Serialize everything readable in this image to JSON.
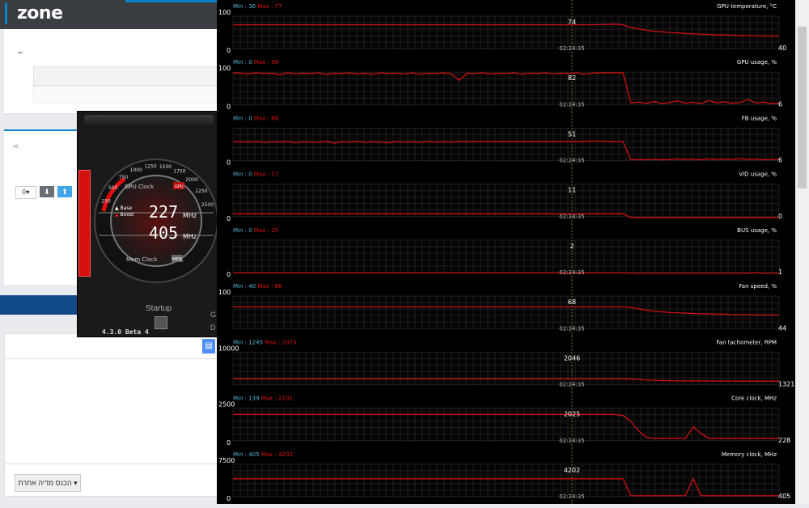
{
  "site": {
    "logo": "zone",
    "like_count": "0",
    "like_heart": "♥",
    "down_arrow": "⬇",
    "up_arrow": "⬆",
    "share_glyph": "⋖",
    "other_media_button": "הכנס מדיה אחרת ▾",
    "doc_glyph": "▤"
  },
  "afterburner": {
    "gpu_clock_label": "GPU Clock",
    "mem_clock_label": "Mem Clock",
    "gpu_badge": "GPU",
    "mem_badge": "MEM",
    "base_label": "Base",
    "boost_label": "Boost",
    "gpu_clock_value": "227",
    "mem_clock_value": "405",
    "unit": "MHz",
    "startup_label": "Startup",
    "version": "4.3.0 Beta 4",
    "side_letters": [
      "G",
      "D"
    ],
    "dial_ticks": [
      "250",
      "500",
      "750",
      "1000",
      "1250",
      "1500",
      "1750",
      "2000",
      "2250",
      "2500"
    ],
    "colors": {
      "accent": "#e01010"
    }
  },
  "monitor": {
    "cursor_time": "02:24:35",
    "graphs": [
      {
        "title": "GPU temperature, °C",
        "min": "36",
        "max": "77",
        "ymax": "100",
        "ymin": "0",
        "cur": "74",
        "end": "40",
        "data": [
          74,
          74,
          74,
          74,
          74,
          74,
          74,
          74,
          74,
          74,
          74,
          74,
          74,
          74,
          74,
          74,
          74,
          74,
          74,
          74,
          74,
          74,
          74,
          74,
          74,
          74,
          74,
          74,
          74,
          74,
          74,
          74,
          74,
          74,
          74,
          74,
          74,
          74,
          74,
          74,
          74,
          74,
          74,
          74,
          74,
          74,
          74,
          75,
          75,
          76,
          74,
          66,
          62,
          58,
          55,
          53,
          51,
          50,
          48,
          47,
          46,
          45,
          44,
          44,
          43,
          42,
          42,
          41,
          41,
          40,
          40
        ]
      },
      {
        "title": "GPU usage, %",
        "min": "0",
        "max": "99",
        "ymax": "100",
        "ymin": "0",
        "cur": "82",
        "end": "6",
        "noisy": true,
        "data": [
          98,
          97,
          95,
          98,
          96,
          97,
          92,
          98,
          95,
          97,
          96,
          98,
          93,
          97,
          96,
          98,
          95,
          97,
          94,
          98,
          96,
          97,
          95,
          98,
          94,
          97,
          96,
          98,
          95,
          75,
          97,
          96,
          98,
          95,
          97,
          96,
          98,
          94,
          97,
          96,
          98,
          95,
          97,
          96,
          98,
          94,
          97,
          98,
          98,
          98,
          98,
          8,
          10,
          7,
          12,
          6,
          9,
          14,
          7,
          10,
          6,
          15,
          8,
          11,
          7,
          9,
          18,
          8,
          10,
          6,
          6
        ]
      },
      {
        "title": "FB usage, %",
        "min": "0",
        "max": "68",
        "ymax": "",
        "ymin": "0",
        "cur": "51",
        "end": "6",
        "noisy": true,
        "data": [
          60,
          59,
          58,
          60,
          57,
          59,
          58,
          60,
          56,
          59,
          58,
          57,
          60,
          55,
          59,
          58,
          60,
          57,
          59,
          58,
          56,
          60,
          58,
          59,
          57,
          60,
          58,
          59,
          58,
          60,
          59,
          60,
          60,
          60,
          60,
          60,
          60,
          60,
          60,
          60,
          60,
          60,
          60,
          60,
          60,
          60,
          61,
          61,
          60,
          60,
          59,
          5,
          6,
          5,
          7,
          5,
          6,
          8,
          6,
          7,
          5,
          8,
          6,
          7,
          6,
          9,
          6,
          7,
          5,
          6,
          6
        ]
      },
      {
        "title": "VID usage, %",
        "min": "0",
        "max": "17",
        "ymax": "",
        "ymin": "0",
        "cur": "11",
        "end": "0",
        "data": [
          11,
          11,
          11,
          11,
          11,
          11,
          11,
          11,
          11,
          11,
          11,
          11,
          11,
          11,
          11,
          11,
          11,
          11,
          11,
          11,
          11,
          11,
          11,
          11,
          11,
          11,
          11,
          11,
          11,
          11,
          11,
          11,
          11,
          11,
          11,
          11,
          11,
          11,
          11,
          11,
          11,
          11,
          11,
          11,
          11,
          11,
          11,
          11,
          11,
          11,
          11,
          0,
          0,
          0,
          0,
          0,
          0,
          0,
          0,
          0,
          0,
          0,
          0,
          0,
          0,
          0,
          0,
          0,
          0,
          0,
          0
        ]
      },
      {
        "title": "BUS usage, %",
        "min": "0",
        "max": "25",
        "ymax": "",
        "ymin": "0",
        "cur": "2",
        "end": "1",
        "data": [
          2,
          2,
          2,
          2,
          2,
          2,
          2,
          2,
          2,
          2,
          2,
          2,
          2,
          2,
          2,
          2,
          2,
          2,
          2,
          2,
          2,
          2,
          2,
          2,
          2,
          2,
          2,
          2,
          2,
          2,
          2,
          2,
          2,
          2,
          2,
          2,
          2,
          2,
          2,
          2,
          2,
          2,
          2,
          2,
          2,
          2,
          2,
          2,
          2,
          2,
          2,
          1,
          1,
          1,
          1,
          1,
          1,
          1,
          1,
          1,
          1,
          1,
          1,
          1,
          1,
          1,
          1,
          2,
          1,
          1,
          1
        ]
      },
      {
        "title": "Fan speed, %",
        "min": "40",
        "max": "68",
        "ymax": "100",
        "ymin": "",
        "cur": "68",
        "end": "44",
        "data": [
          68,
          68,
          68,
          68,
          68,
          68,
          68,
          68,
          68,
          68,
          68,
          68,
          68,
          68,
          68,
          68,
          68,
          68,
          68,
          68,
          68,
          68,
          68,
          68,
          68,
          68,
          68,
          68,
          68,
          68,
          68,
          68,
          68,
          68,
          68,
          68,
          68,
          68,
          68,
          68,
          68,
          68,
          68,
          68,
          68,
          68,
          68,
          68,
          68,
          68,
          68,
          66,
          62,
          58,
          55,
          53,
          51,
          50,
          49,
          48,
          47,
          47,
          46,
          46,
          45,
          45,
          45,
          44,
          44,
          44,
          44
        ]
      },
      {
        "title": "Fan tachometer, RPM",
        "min": "1245",
        "max": "2073",
        "ymax": "10000",
        "ymin": "",
        "cur": "2046",
        "end": "1321",
        "data": [
          2046,
          2046,
          2046,
          2046,
          2046,
          2046,
          2046,
          2046,
          2046,
          2046,
          2046,
          2046,
          2046,
          2046,
          2046,
          2046,
          2046,
          2046,
          2046,
          2046,
          2046,
          2046,
          2046,
          2046,
          2046,
          2046,
          2046,
          2046,
          2046,
          2046,
          2046,
          2046,
          2046,
          2046,
          2046,
          2046,
          2046,
          2046,
          2046,
          2046,
          2046,
          2046,
          2046,
          2046,
          2046,
          2046,
          2046,
          2046,
          2046,
          2046,
          2046,
          1950,
          1800,
          1650,
          1550,
          1480,
          1430,
          1400,
          1380,
          1370,
          1360,
          1350,
          1345,
          1340,
          1335,
          1330,
          1328,
          1325,
          1323,
          1321,
          1321
        ]
      },
      {
        "title": "Core clock, MHz",
        "min": "139",
        "max": "2101",
        "ymax": "2500",
        "ymin": "0",
        "cur": "2025",
        "end": "228",
        "data": [
          2025,
          2025,
          2025,
          2025,
          2025,
          2025,
          2025,
          2025,
          2025,
          2025,
          2025,
          2025,
          2025,
          2025,
          2025,
          2025,
          2025,
          2025,
          2025,
          2025,
          2025,
          2025,
          2025,
          2025,
          2025,
          2025,
          2025,
          2025,
          2025,
          2025,
          2025,
          2025,
          2025,
          2025,
          2025,
          2025,
          2025,
          2025,
          2025,
          2025,
          2025,
          2025,
          2025,
          2025,
          2025,
          2025,
          2025,
          2025,
          2025,
          2025,
          1950,
          1500,
          800,
          300,
          228,
          228,
          228,
          228,
          228,
          1100,
          600,
          228,
          228,
          228,
          228,
          228,
          228,
          228,
          228,
          228,
          228
        ]
      },
      {
        "title": "Memory clock, MHz",
        "min": "405",
        "max": "4202",
        "ymax": "7500",
        "ymin": "0",
        "cur": "4202",
        "end": "405",
        "data": [
          4202,
          4202,
          4202,
          4202,
          4202,
          4202,
          4202,
          4202,
          4202,
          4202,
          4202,
          4202,
          4202,
          4202,
          4202,
          4202,
          4202,
          4202,
          4202,
          4202,
          4202,
          4202,
          4202,
          4202,
          4202,
          4202,
          4202,
          4202,
          4202,
          4202,
          4202,
          4202,
          4202,
          4202,
          4202,
          4202,
          4202,
          4202,
          4202,
          4202,
          4202,
          4202,
          4202,
          4202,
          4202,
          4202,
          4202,
          4202,
          4202,
          4202,
          4202,
          405,
          405,
          405,
          405,
          405,
          405,
          405,
          405,
          4202,
          405,
          405,
          405,
          405,
          405,
          405,
          405,
          405,
          405,
          405,
          405
        ]
      }
    ]
  }
}
